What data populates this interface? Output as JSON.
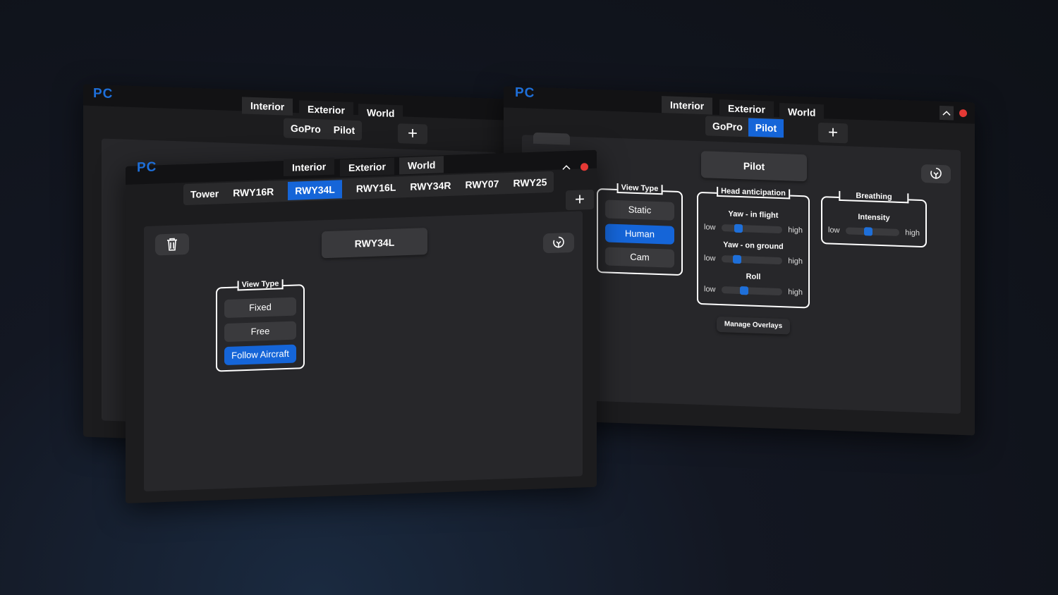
{
  "back_left": {
    "brand": "PC",
    "tabs": [
      "Interior",
      "Exterior",
      "World"
    ],
    "subtabs": [
      "GoPro",
      "Pilot"
    ],
    "plus": "+"
  },
  "back_right": {
    "brand": "PC",
    "tabs": [
      "Interior",
      "Exterior",
      "World"
    ],
    "subtabs": [
      "GoPro",
      "Pilot"
    ],
    "active_subtab": "Pilot",
    "plus": "+",
    "collapse": "^",
    "title_button": "Pilot",
    "view_type": {
      "title": "View Type",
      "options": [
        "Static",
        "Human",
        "Cam"
      ],
      "selected": "Human"
    },
    "head_anticipation": {
      "title": "Head anticipation",
      "sliders": [
        {
          "label": "Yaw - in flight",
          "low": "low",
          "high": "high",
          "value": 0.28
        },
        {
          "label": "Yaw - on ground",
          "low": "low",
          "high": "high",
          "value": 0.26
        },
        {
          "label": "Roll",
          "low": "low",
          "high": "high",
          "value": 0.37
        }
      ]
    },
    "breathing": {
      "title": "Breathing",
      "sliders": [
        {
          "label": "Intensity",
          "low": "low",
          "high": "high",
          "value": 0.42
        }
      ]
    },
    "manage_overlays": "Manage Overlays"
  },
  "front": {
    "brand": "PC",
    "tabs": [
      "Interior",
      "Exterior",
      "World"
    ],
    "active_tab": "World",
    "subtabs": [
      "Tower",
      "RWY16R",
      "RWY34L",
      "RWY16L",
      "RWY34R",
      "RWY07",
      "RWY25"
    ],
    "active_subtab": "RWY34L",
    "plus": "+",
    "collapse": "^",
    "title_button": "RWY34L",
    "view_type": {
      "title": "View Type",
      "options": [
        "Fixed",
        "Free",
        "Follow Aircraft"
      ],
      "selected": "Follow Aircraft"
    }
  },
  "colors": {
    "accent": "#1565d8",
    "brand": "#1e6fd9",
    "close": "#e53935"
  }
}
